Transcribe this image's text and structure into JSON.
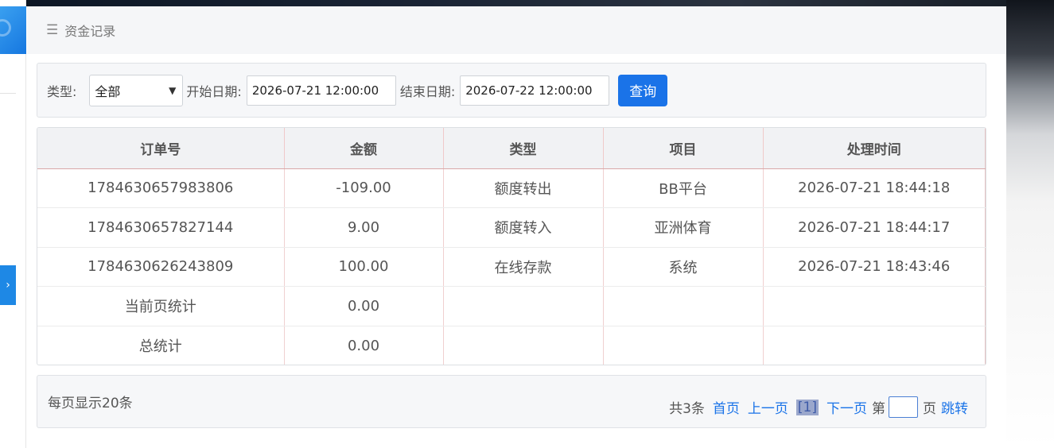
{
  "header": {
    "title": "资金记录"
  },
  "filter": {
    "type_label": "类型:",
    "type_value": "全部",
    "start_label": "开始日期:",
    "start_value": "2026-07-21 12:00:00",
    "end_label": "结束日期:",
    "end_value": "2026-07-22 12:00:00",
    "query_label": "查询"
  },
  "table": {
    "columns": [
      "订单号",
      "金额",
      "类型",
      "项目",
      "处理时间"
    ],
    "rows": [
      [
        "1784630657983806",
        "-109.00",
        "额度转出",
        "BB平台",
        "2026-07-21 18:44:18"
      ],
      [
        "1784630657827144",
        "9.00",
        "额度转入",
        "亚洲体育",
        "2026-07-21 18:44:17"
      ],
      [
        "1784630626243809",
        "100.00",
        "在线存款",
        "系统",
        "2026-07-21 18:43:46"
      ]
    ],
    "page_total_label": "当前页统计",
    "page_total_value": "0.00",
    "grand_total_label": "总统计",
    "grand_total_value": "0.00"
  },
  "pager": {
    "per_page": "每页显示20条",
    "total": "共3条",
    "first": "首页",
    "prev": "上一页",
    "current": "[1]",
    "next": "下一页",
    "page_prefix": "第",
    "page_suffix": "页",
    "jump": "跳转"
  }
}
